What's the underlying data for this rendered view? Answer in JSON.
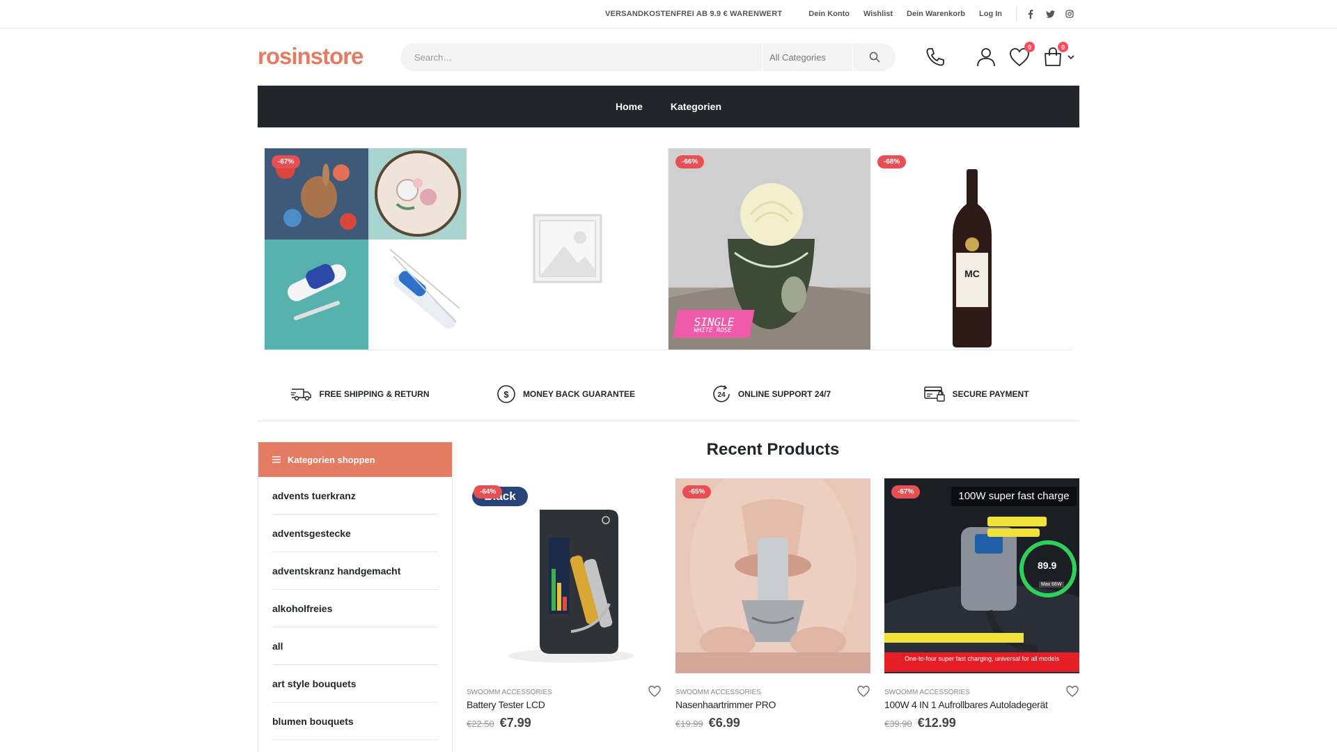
{
  "topbar": {
    "promo": "VERSANDKOSTENFREI AB 9.9 € WARENWERT",
    "links": [
      "Dein Konto",
      "Wishlist",
      "Dein Warenkorb",
      "Log In"
    ],
    "social_icons": [
      "facebook-icon",
      "twitter-icon",
      "instagram-icon"
    ]
  },
  "header": {
    "logo": "rosinstore",
    "search_placeholder": "Search…",
    "category_select": "All Categories",
    "wishlist_count": "0",
    "cart_count": "0"
  },
  "nav": {
    "items": [
      "Home",
      "Kategorien"
    ]
  },
  "featured": [
    {
      "discount": "-67%"
    },
    {
      "discount": ""
    },
    {
      "discount": "-66%",
      "overlay_text": "SINGLE",
      "overlay_sub": "WHITE ROSE"
    },
    {
      "discount": "-68%",
      "label_text": "MC"
    }
  ],
  "features": [
    {
      "icon": "truck-icon",
      "label": "FREE SHIPPING & RETURN"
    },
    {
      "icon": "dollar-icon",
      "label": "MONEY BACK GUARANTEE"
    },
    {
      "icon": "support-24-icon",
      "label": "ONLINE SUPPORT 24/7"
    },
    {
      "icon": "credit-card-icon",
      "label": "SECURE PAYMENT"
    }
  ],
  "sidebar": {
    "title": "Kategorien shoppen",
    "items": [
      "advents tuerkranz",
      "adventsgestecke",
      "adventskranz handgemacht",
      "alkoholfreies",
      "all",
      "art style bouquets",
      "blumen bouquets"
    ]
  },
  "recent": {
    "title": "Recent Products",
    "products": [
      {
        "discount": "-64%",
        "category": "SWOOMM ACCESSORIES",
        "title": "Battery Tester LCD",
        "old_price": "€22.50",
        "price": "€7.99",
        "img_text": "Black"
      },
      {
        "discount": "-65%",
        "category": "SWOOMM ACCESSORIES",
        "title": "Nasenhaartrimmer PRO",
        "old_price": "€19.99",
        "price": "€6.99"
      },
      {
        "discount": "-67%",
        "category": "SWOOMM ACCESSORIES",
        "title": "100W 4 IN 1 Aufrollbares Autoladegerät",
        "old_price": "€39.90",
        "price": "€12.99",
        "img_headline": "100W super fast charge",
        "img_footer": "One-to-four super fast charging, universal for all models",
        "img_display": "89.9",
        "img_tag": "Max 66W"
      }
    ]
  },
  "colors": {
    "brand": "#e47c64",
    "dark": "#222529",
    "sale": "#e65055"
  }
}
